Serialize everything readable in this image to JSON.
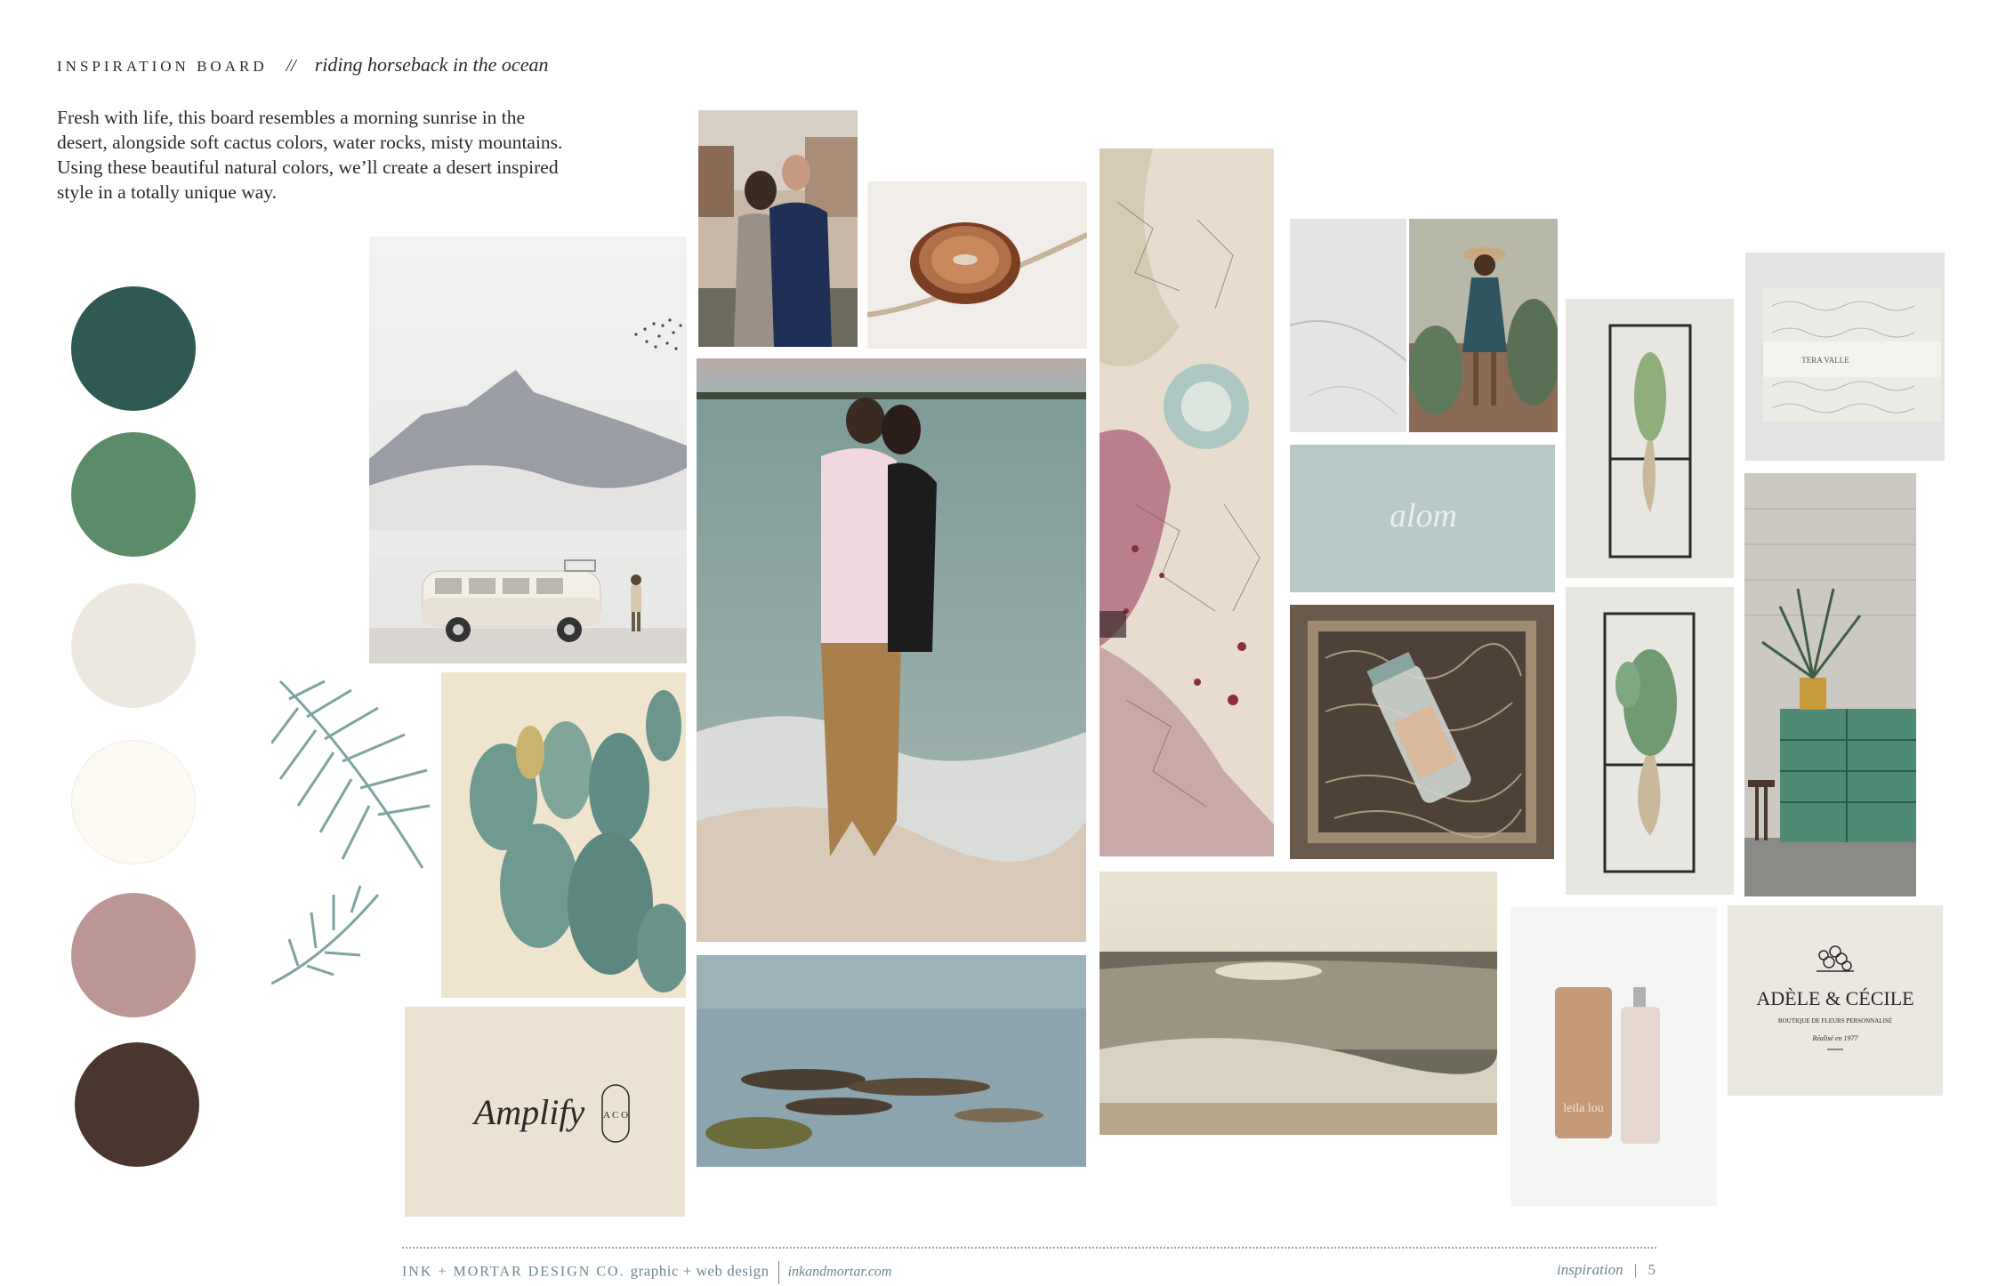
{
  "header": {
    "title": "INSPIRATION BOARD",
    "separator": "//",
    "subtitle": "riding horseback in the ocean"
  },
  "intro": "Fresh with life, this board resembles a morning sunrise in the desert, alongside soft cactus colors, water rocks, misty mountains. Using these beautiful natural colors, we’ll create a desert inspired style in a totally unique way.",
  "palette": [
    "#2f5a54",
    "#5b8c69",
    "#ede8df",
    "#fbf9f2",
    "#bc9694",
    "#4a362f"
  ],
  "cards": {
    "amplify_script": "Amplify",
    "amplify_letters": "A C O",
    "aloru": "alom",
    "adele_title": "ADÈLE & CÉCILE",
    "adele_sub": "BOUTIQUE DE FLEURS PERSONNALISÉ",
    "adele_date": "Réalisé en 1977",
    "leila": "leila lou",
    "tera": "TERA VALLE"
  },
  "footer": {
    "company": "INK + MORTAR DESIGN CO.",
    "tagline": "graphic + web design",
    "url": "inkandmortar.com",
    "section": "inspiration",
    "page_sep": "|",
    "page": "5"
  }
}
